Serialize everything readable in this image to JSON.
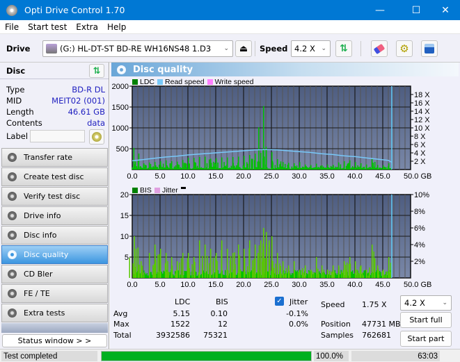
{
  "window": {
    "title": "Opti Drive Control 1.70",
    "minimize": "—",
    "maximize": "☐",
    "close": "✕"
  },
  "menu": [
    "File",
    "Start test",
    "Extra",
    "Help"
  ],
  "toolbar": {
    "drive_label": "Drive",
    "drive_value": "(G:)   HL-DT-ST BD-RE  WH16NS48 1.D3",
    "speed_label": "Speed",
    "speed_value": "4.2 X"
  },
  "disc": {
    "header": "Disc",
    "type_label": "Type",
    "type_value": "BD-R DL",
    "mid_label": "MID",
    "mid_value": "MEIT02 (001)",
    "length_label": "Length",
    "length_value": "46.61 GB",
    "contents_label": "Contents",
    "contents_value": "data",
    "label_label": "Label",
    "label_value": ""
  },
  "nav": [
    {
      "label": "Transfer rate",
      "active": false
    },
    {
      "label": "Create test disc",
      "active": false
    },
    {
      "label": "Verify test disc",
      "active": false
    },
    {
      "label": "Drive info",
      "active": false
    },
    {
      "label": "Disc info",
      "active": false
    },
    {
      "label": "Disc quality",
      "active": true
    },
    {
      "label": "CD Bler",
      "active": false
    },
    {
      "label": "FE / TE",
      "active": false
    },
    {
      "label": "Extra tests",
      "active": false
    }
  ],
  "status_window_label": "Status window > >",
  "panel_title": "Disc quality",
  "colors": {
    "ldc": "#00c000",
    "bis": "#00c000",
    "read_speed": "#78c8f8",
    "write_speed": "#ff80ff",
    "jitter": "#e0a0e0",
    "plot_bg_top": "#4e5d80",
    "plot_bg_bottom": "#7a88a8",
    "progress": "#00b020"
  },
  "chart_data": [
    {
      "type": "bar",
      "title": "LDC / Read speed",
      "legend": [
        "LDC",
        "Read speed",
        "Write speed"
      ],
      "legend_position": "top-left",
      "xlabel": "GB",
      "x_ticks": [
        "0.0",
        "5.0",
        "10.0",
        "15.0",
        "20.0",
        "25.0",
        "30.0",
        "35.0",
        "40.0",
        "45.0",
        "50.0 GB"
      ],
      "xlim": [
        0,
        50
      ],
      "y_left_ticks": [
        "2000",
        "1500",
        "1000",
        "500"
      ],
      "ylim_left": [
        0,
        2000
      ],
      "y_right_ticks": [
        "18 X",
        "16 X",
        "14 X",
        "12 X",
        "10 X",
        "8 X",
        "6 X",
        "4 X",
        "2 X"
      ],
      "ylim_right": [
        0,
        20
      ],
      "grid": true,
      "end_marker_gb": 46.61,
      "ldc_series": {
        "name": "LDC",
        "x_gb": [
          0.2,
          0.5,
          1.0,
          2.0,
          3.0,
          4.0,
          5.0,
          6.0,
          7.0,
          8.0,
          9.0,
          10.0,
          11.0,
          12.0,
          13.0,
          14.0,
          15.0,
          16.0,
          17.0,
          18.0,
          19.0,
          20.0,
          21.0,
          22.0,
          23.0,
          23.5,
          24.0,
          25.0,
          26.0,
          27.0,
          28.0,
          29.0,
          30.0,
          31.0,
          32.0,
          33.0,
          34.0,
          35.0,
          36.0,
          37.0,
          38.0,
          39.0,
          40.0,
          41.0,
          42.0,
          43.0,
          44.0,
          45.0,
          46.0,
          46.5
        ],
        "values": [
          520,
          180,
          200,
          150,
          170,
          180,
          200,
          220,
          200,
          190,
          230,
          280,
          280,
          300,
          310,
          260,
          270,
          290,
          290,
          300,
          310,
          330,
          350,
          380,
          400,
          1522,
          480,
          420,
          250,
          180,
          160,
          150,
          180,
          120,
          110,
          140,
          100,
          120,
          110,
          170,
          200,
          220,
          180,
          150,
          120,
          260,
          110,
          100,
          150,
          120
        ]
      },
      "read_speed_series": {
        "name": "Read speed",
        "x_gb": [
          0,
          2,
          4,
          6,
          8,
          10,
          12,
          14,
          16,
          18,
          20,
          22,
          24,
          26,
          28,
          30,
          32,
          34,
          36,
          38,
          40,
          42,
          44,
          46,
          46.61
        ],
        "values": [
          2.1,
          2.4,
          2.7,
          3.0,
          3.2,
          3.5,
          3.7,
          3.9,
          4.1,
          4.3,
          4.5,
          4.7,
          4.8,
          4.7,
          4.5,
          4.3,
          4.1,
          3.8,
          3.6,
          3.3,
          3.1,
          2.8,
          2.5,
          2.2,
          1.75
        ]
      }
    },
    {
      "type": "bar",
      "title": "BIS / Jitter",
      "legend": [
        "BIS",
        "Jitter"
      ],
      "legend_position": "top-left",
      "xlabel": "GB",
      "x_ticks": [
        "0.0",
        "5.0",
        "10.0",
        "15.0",
        "20.0",
        "25.0",
        "30.0",
        "35.0",
        "40.0",
        "45.0",
        "50.0 GB"
      ],
      "xlim": [
        0,
        50
      ],
      "y_left_ticks": [
        "20",
        "15",
        "10",
        "5"
      ],
      "ylim_left": [
        0,
        20
      ],
      "y_right_ticks": [
        "10%",
        "8%",
        "6%",
        "4%",
        "2%"
      ],
      "ylim_right": [
        0,
        10
      ],
      "grid": true,
      "end_marker_gb": 46.61,
      "bis_series": {
        "name": "BIS",
        "x_gb": [
          0.3,
          0.6,
          1.5,
          3.0,
          4.0,
          5.0,
          6.0,
          7.0,
          8.0,
          9.0,
          10.0,
          11.0,
          12.0,
          13.0,
          14.0,
          15.0,
          16.0,
          17.0,
          18.0,
          19.0,
          20.0,
          21.0,
          22.0,
          23.0,
          23.5,
          24.0,
          24.5,
          25.0,
          26.0,
          27.0,
          28.0,
          29.0,
          30.0,
          31.0,
          32.0,
          33.0,
          34.0,
          35.0,
          36.0,
          37.0,
          38.0,
          39.0,
          40.0,
          41.0,
          42.0,
          43.0,
          44.0,
          45.0,
          46.0,
          46.5
        ],
        "values": [
          10,
          7,
          4,
          6,
          8,
          7,
          6,
          5,
          4,
          6,
          6,
          5,
          9,
          8,
          7,
          6,
          9,
          7,
          6,
          8,
          7,
          9,
          8,
          9,
          12,
          11,
          9,
          10,
          6,
          4,
          3,
          4,
          2,
          3,
          2,
          5,
          3,
          2,
          3,
          3,
          4,
          5,
          4,
          3,
          2,
          8,
          3,
          2,
          5,
          5
        ]
      }
    }
  ],
  "stats": {
    "col_ldc": "LDC",
    "col_bis": "BIS",
    "jitter_label": "Jitter",
    "jitter_checked": true,
    "avg_label": "Avg",
    "avg_ldc": "5.15",
    "avg_bis": "0.10",
    "avg_jitter": "-0.1%",
    "max_label": "Max",
    "max_ldc": "1522",
    "max_bis": "12",
    "max_jitter": "0.0%",
    "total_label": "Total",
    "total_ldc": "3932586",
    "total_bis": "75321",
    "speed_label": "Speed",
    "speed_value": "1.75 X",
    "speed_select": "4.2 X",
    "position_label": "Position",
    "position_value": "47731 MB",
    "samples_label": "Samples",
    "samples_value": "762681",
    "start_full": "Start full",
    "start_part": "Start part"
  },
  "statusbar": {
    "text": "Test completed",
    "progress": 100.0,
    "progress_text": "100.0%",
    "elapsed": "63:03"
  }
}
